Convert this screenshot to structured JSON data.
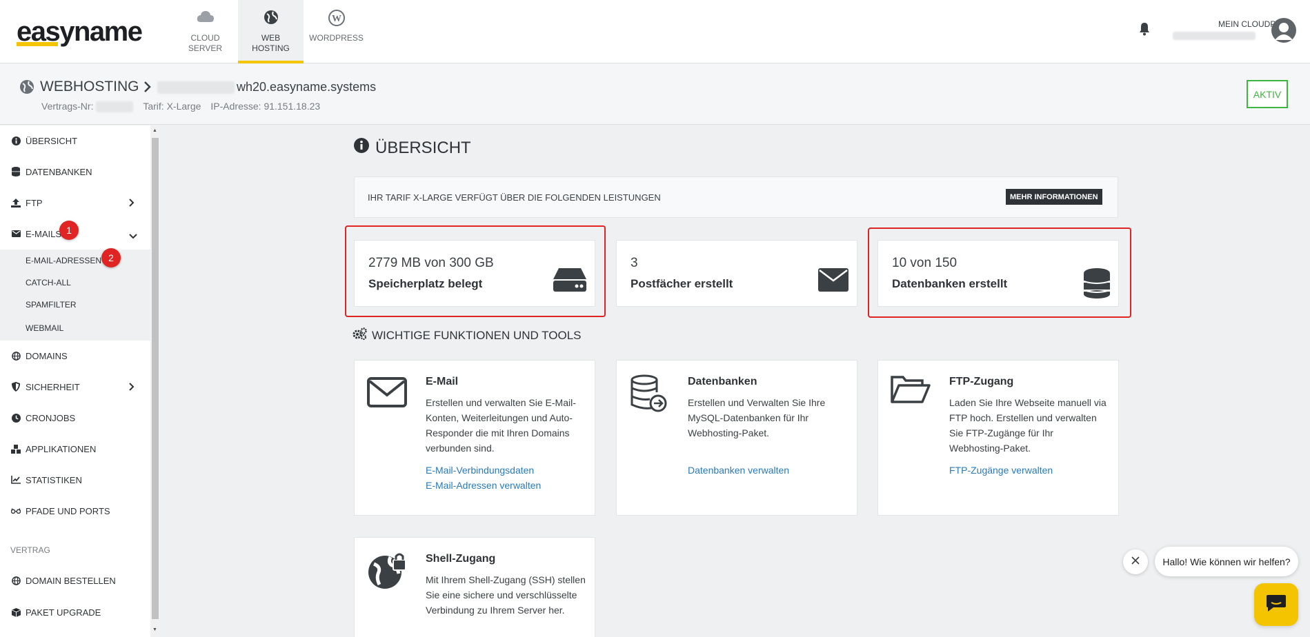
{
  "header": {
    "logo": "easyname",
    "nav": [
      {
        "label": "CLOUD\nSERVER",
        "icon": "cloud-icon",
        "active": false
      },
      {
        "label": "WEB\nHOSTING",
        "icon": "globe-icon",
        "active": true
      },
      {
        "label": "WORDPRESS",
        "icon": "wordpress-icon",
        "active": false
      }
    ],
    "account_label": "MEIN CLOUDPIT"
  },
  "subheader": {
    "title": "WEBHOSTING",
    "host": "wh20.easyname.systems",
    "vertrag_label": "Vertrags-Nr:",
    "tarif_label": "Tarif:",
    "tarif_value": "X-Large",
    "ip_label": "IP-Adresse:",
    "ip_value": "91.151.18.23",
    "status": "AKTIV"
  },
  "sidebar": {
    "items": [
      {
        "label": "ÜBERSICHT",
        "icon": "info-icon"
      },
      {
        "label": "DATENBANKEN",
        "icon": "database-icon"
      },
      {
        "label": "FTP",
        "icon": "upload-icon"
      },
      {
        "label": "E-MAILS",
        "icon": "envelope-icon"
      },
      {
        "label": "DOMAINS",
        "icon": "globe-icon"
      },
      {
        "label": "SICHERHEIT",
        "icon": "shield-icon"
      },
      {
        "label": "CRONJOBS",
        "icon": "clock-icon"
      },
      {
        "label": "APPLIKATIONEN",
        "icon": "boxes-icon"
      },
      {
        "label": "STATISTIKEN",
        "icon": "chart-icon"
      },
      {
        "label": "PFADE UND PORTS",
        "icon": "glasses-icon"
      },
      {
        "label": "DOMAIN BESTELLEN",
        "icon": "globe-icon"
      },
      {
        "label": "PAKET UPGRADE",
        "icon": "box-icon"
      }
    ],
    "email_sub": [
      "E-MAIL-ADRESSEN",
      "CATCH-ALL",
      "SPAMFILTER",
      "WEBMAIL"
    ],
    "section_vertrag": "VERTRAG",
    "badges": [
      "1",
      "2"
    ]
  },
  "main": {
    "title": "ÜBERSICHT",
    "tarif_text": "IHR TARIF X-LARGE VERFÜGT ÜBER DIE FOLGENDEN LEISTUNGEN",
    "mehr_button": "MEHR INFORMATIONEN",
    "stats": [
      {
        "value": "2779 MB von 300 GB",
        "label": "Speicherplatz belegt",
        "icon": "harddrive-icon"
      },
      {
        "value": "3",
        "label": "Postfächer erstellt",
        "icon": "envelope-icon"
      },
      {
        "value": "10 von 150",
        "label": "Datenbanken erstellt",
        "icon": "database-icon"
      }
    ],
    "tools_title": "WICHTIGE FUNKTIONEN UND TOOLS",
    "cards": [
      {
        "title": "E-Mail",
        "desc": "Erstellen und verwalten Sie E-Mail-Konten, Weiterleitungen und Auto-Responder die mit Ihren Domains verbunden sind.",
        "links": [
          "E-Mail-Verbindungsdaten",
          "E-Mail-Adressen verwalten"
        ]
      },
      {
        "title": "Datenbanken",
        "desc": "Erstellen und Verwalten Sie Ihre MySQL-Datenbanken für Ihr Webhosting-Paket.",
        "links": [
          "Datenbanken verwalten"
        ]
      },
      {
        "title": "FTP-Zugang",
        "desc": "Laden Sie Ihre Webseite manuell via FTP hoch. Erstellen und verwalten Sie FTP-Zugänge für Ihr Webhosting-Paket.",
        "links": [
          "FTP-Zugänge verwalten"
        ]
      },
      {
        "title": "Shell-Zugang",
        "desc": "Mit Ihrem Shell-Zugang (SSH) stellen Sie eine sichere und verschlüsselte Verbindung zu Ihrem Server her.",
        "links": []
      }
    ]
  },
  "chat": {
    "message": "Hallo! Wie können wir helfen?"
  },
  "colors": {
    "brand_yellow": "#f5c400",
    "highlight_red": "#e02424",
    "status_green": "#3fb53f",
    "link_blue": "#2a7ab8"
  }
}
